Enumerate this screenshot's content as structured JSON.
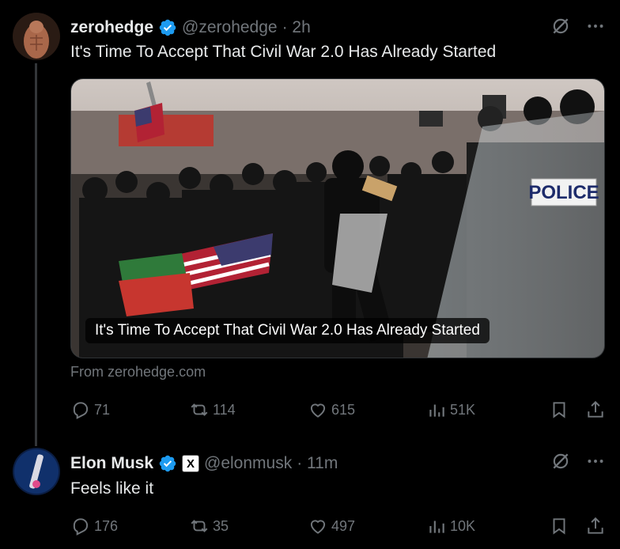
{
  "tweets": [
    {
      "author_name": "zerohedge",
      "handle": "@zerohedge",
      "time": "· 2h",
      "text": "It's Time To Accept That Civil War 2.0 Has Already Started",
      "card_caption": "It's Time To Accept That Civil War 2.0 Has Already Started",
      "card_sign": "POLICE",
      "from_domain": "From zerohedge.com",
      "replies": "71",
      "retweets": "114",
      "likes": "615",
      "views": "51K"
    },
    {
      "author_name": "Elon Musk",
      "handle": "@elonmusk",
      "time": "· 11m",
      "xbadge": "X",
      "text": "Feels like it",
      "replies": "176",
      "retweets": "35",
      "likes": "497",
      "views": "10K"
    }
  ],
  "icons": {
    "verified": "verified-badge-icon",
    "grok": "grok-icon",
    "more": "more-icon",
    "reply": "reply-icon",
    "retweet": "retweet-icon",
    "like": "like-icon",
    "views": "views-icon",
    "bookmark": "bookmark-icon",
    "share": "share-icon"
  },
  "colors": {
    "background": "#000000",
    "text": "#e7e9ea",
    "muted": "#71767b",
    "verified": "#1d9bf0"
  }
}
